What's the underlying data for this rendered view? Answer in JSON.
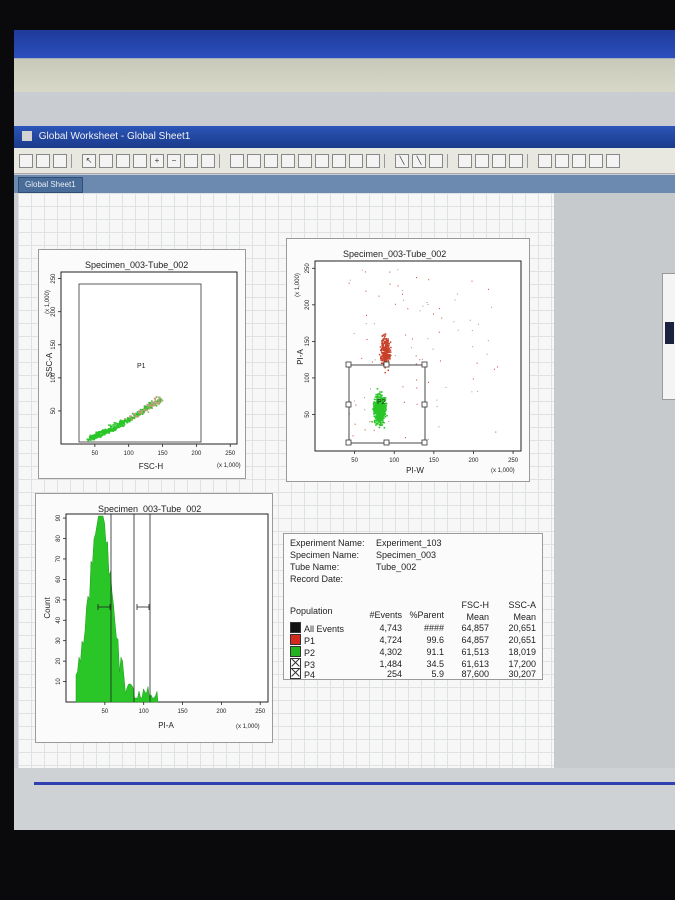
{
  "window": {
    "title": "Global Worksheet - Global Sheet1",
    "tab": "Global Sheet1"
  },
  "plots": {
    "plot1": {
      "title": "Specimen_003-Tube_002",
      "xlabel": "FSC-H",
      "ylabel": "SSC-A",
      "scale_note_x": "(x 1,000)",
      "scale_note_y": "(x 1,000)",
      "xticks": [
        "50",
        "100",
        "150",
        "200",
        "250"
      ],
      "yticks": [
        "50",
        "100",
        "150",
        "200",
        "250"
      ],
      "gate_label": "P1"
    },
    "plot2": {
      "title": "Specimen_003-Tube_002",
      "xlabel": "PI-W",
      "ylabel": "PI-A",
      "scale_note_x": "(x 1,000)",
      "scale_note_y": "(x 1,000)",
      "xticks": [
        "50",
        "100",
        "150",
        "200",
        "250"
      ],
      "yticks": [
        "50",
        "100",
        "150",
        "200",
        "250"
      ],
      "gate_label": "P2"
    },
    "plot3": {
      "title": "Specimen_003-Tube_002",
      "xlabel": "PI-A",
      "ylabel": "Count",
      "scale_note_x": "(x 1,000)",
      "xticks": [
        "50",
        "100",
        "150",
        "200",
        "250"
      ],
      "yticks": [
        "10",
        "20",
        "30",
        "40",
        "50",
        "60",
        "70",
        "80",
        "90"
      ]
    }
  },
  "stats": {
    "experiment_name_label": "Experiment Name:",
    "experiment_name": "Experiment_103",
    "specimen_name_label": "Specimen Name:",
    "specimen_name": "Specimen_003",
    "tube_name_label": "Tube Name:",
    "tube_name": "Tube_002",
    "record_date_label": "Record Date:",
    "headers": {
      "population": "Population",
      "events": "#Events",
      "parent": "%Parent",
      "fsch": "FSC-H",
      "fsch_sub": "Mean",
      "ssca": "SSC-A",
      "ssca_sub": "Mean"
    },
    "rows": [
      {
        "name": "All Events",
        "color": "#111111",
        "events": "4,743",
        "parent": "####",
        "fsch": "64,857",
        "ssca": "20,651"
      },
      {
        "name": "P1",
        "color": "#d42a1e",
        "events": "4,724",
        "parent": "99.6",
        "fsch": "64,857",
        "ssca": "20,651"
      },
      {
        "name": "P2",
        "color": "#22b41e",
        "events": "4,302",
        "parent": "91.1",
        "fsch": "61,513",
        "ssca": "18,019"
      },
      {
        "name": "P3",
        "color": "#ffffff",
        "events": "1,484",
        "parent": "34.5",
        "fsch": "61,613",
        "ssca": "17,200"
      },
      {
        "name": "P4",
        "color": "#ffffff",
        "events": "254",
        "parent": "5.9",
        "fsch": "87,600",
        "ssca": "30,207"
      }
    ]
  },
  "colors": {
    "events_green": "#2ac628",
    "events_red": "#c8402a",
    "titlebar": "#1b3a8a"
  }
}
